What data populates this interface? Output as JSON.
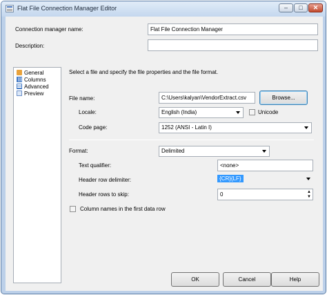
{
  "window": {
    "title": "Flat File Connection Manager Editor"
  },
  "general": {
    "connection_name_label": "Connection manager name:",
    "connection_name_value": "Flat File Connection Manager",
    "description_label": "Description:",
    "description_value": ""
  },
  "nav": {
    "items": [
      {
        "label": "General",
        "icon": "general-icon",
        "icon_color": "#e9a23b"
      },
      {
        "label": "Columns",
        "icon": "columns-icon",
        "icon_color": "#4a7fc8"
      },
      {
        "label": "Advanced",
        "icon": "advanced-icon",
        "icon_color": "#4a7fc8"
      },
      {
        "label": "Preview",
        "icon": "preview-icon",
        "icon_color": "#6b8fc8"
      }
    ],
    "selected": "General"
  },
  "main": {
    "instructions": "Select a file and specify the file properties and the file format.",
    "file_name_label": "File name:",
    "file_name_value": "C:\\Users\\kalyan\\VendorExtract.csv",
    "browse_label": "Browse...",
    "locale_label": "Locale:",
    "locale_value": "English (India)",
    "unicode_label": "Unicode",
    "code_page_label": "Code page:",
    "code_page_value": "1252  (ANSI - Latin I)",
    "format_label": "Format:",
    "format_value": "Delimited",
    "text_qualifier_label": "Text qualifier:",
    "text_qualifier_value": "<none>",
    "header_row_delimiter_label": "Header row delimiter:",
    "header_row_delimiter_value": "{CR}{LF}",
    "header_rows_skip_label": "Header rows to skip:",
    "header_rows_skip_value": "0",
    "column_names_label": "Column names in the first data row"
  },
  "footer": {
    "ok_label": "OK",
    "cancel_label": "Cancel",
    "help_label": "Help"
  },
  "colors": {
    "accent": "#3399ff",
    "title_bar": "#c4d7ee",
    "close_button": "#c24a2e"
  }
}
